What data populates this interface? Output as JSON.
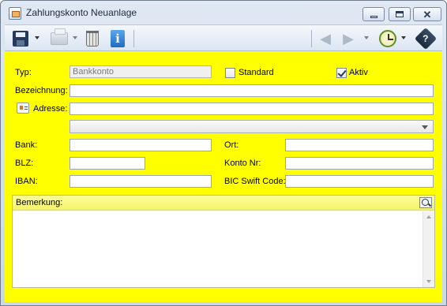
{
  "window": {
    "title": "Zahlungskonto Neuanlage",
    "controls": [
      "minimize",
      "maximize",
      "close"
    ]
  },
  "toolbar": {
    "items": [
      {
        "name": "save",
        "icon": "floppy-disk-icon",
        "has_dropdown": true,
        "enabled": true
      },
      {
        "name": "print",
        "icon": "printer-icon",
        "has_dropdown": true,
        "enabled": false
      },
      {
        "name": "delete",
        "icon": "trash-icon",
        "enabled": true
      },
      {
        "name": "info",
        "icon": "info-icon",
        "enabled": true
      },
      {
        "name": "back",
        "icon": "arrow-left-icon",
        "enabled": false
      },
      {
        "name": "forward",
        "icon": "arrow-right-icon",
        "has_dropdown": true,
        "enabled": false
      },
      {
        "name": "history",
        "icon": "clock-icon",
        "has_dropdown": true,
        "enabled": true
      },
      {
        "name": "help",
        "icon": "help-book-icon",
        "enabled": true
      }
    ]
  },
  "form": {
    "background": "#ffff00",
    "typ": {
      "label": "Typ:",
      "value": "Bankkonto"
    },
    "standard": {
      "label": "Standard",
      "checked": false
    },
    "aktiv": {
      "label": "Aktiv",
      "checked": true
    },
    "bezeichnung": {
      "label": "Bezeichnung:",
      "value": ""
    },
    "adresse": {
      "label": "Adresse:",
      "value": "",
      "select_value": ""
    },
    "bank": {
      "label": "Bank:",
      "value": ""
    },
    "ort": {
      "label": "Ort:",
      "value": ""
    },
    "blz": {
      "label": "BLZ:",
      "value": ""
    },
    "konto_nr": {
      "label": "Konto Nr:",
      "value": ""
    },
    "iban": {
      "label": "IBAN:",
      "value": ""
    },
    "bic": {
      "label": "BIC Swift Code:",
      "value": ""
    },
    "bemerkung": {
      "label": "Bemerkung:",
      "value": ""
    }
  }
}
